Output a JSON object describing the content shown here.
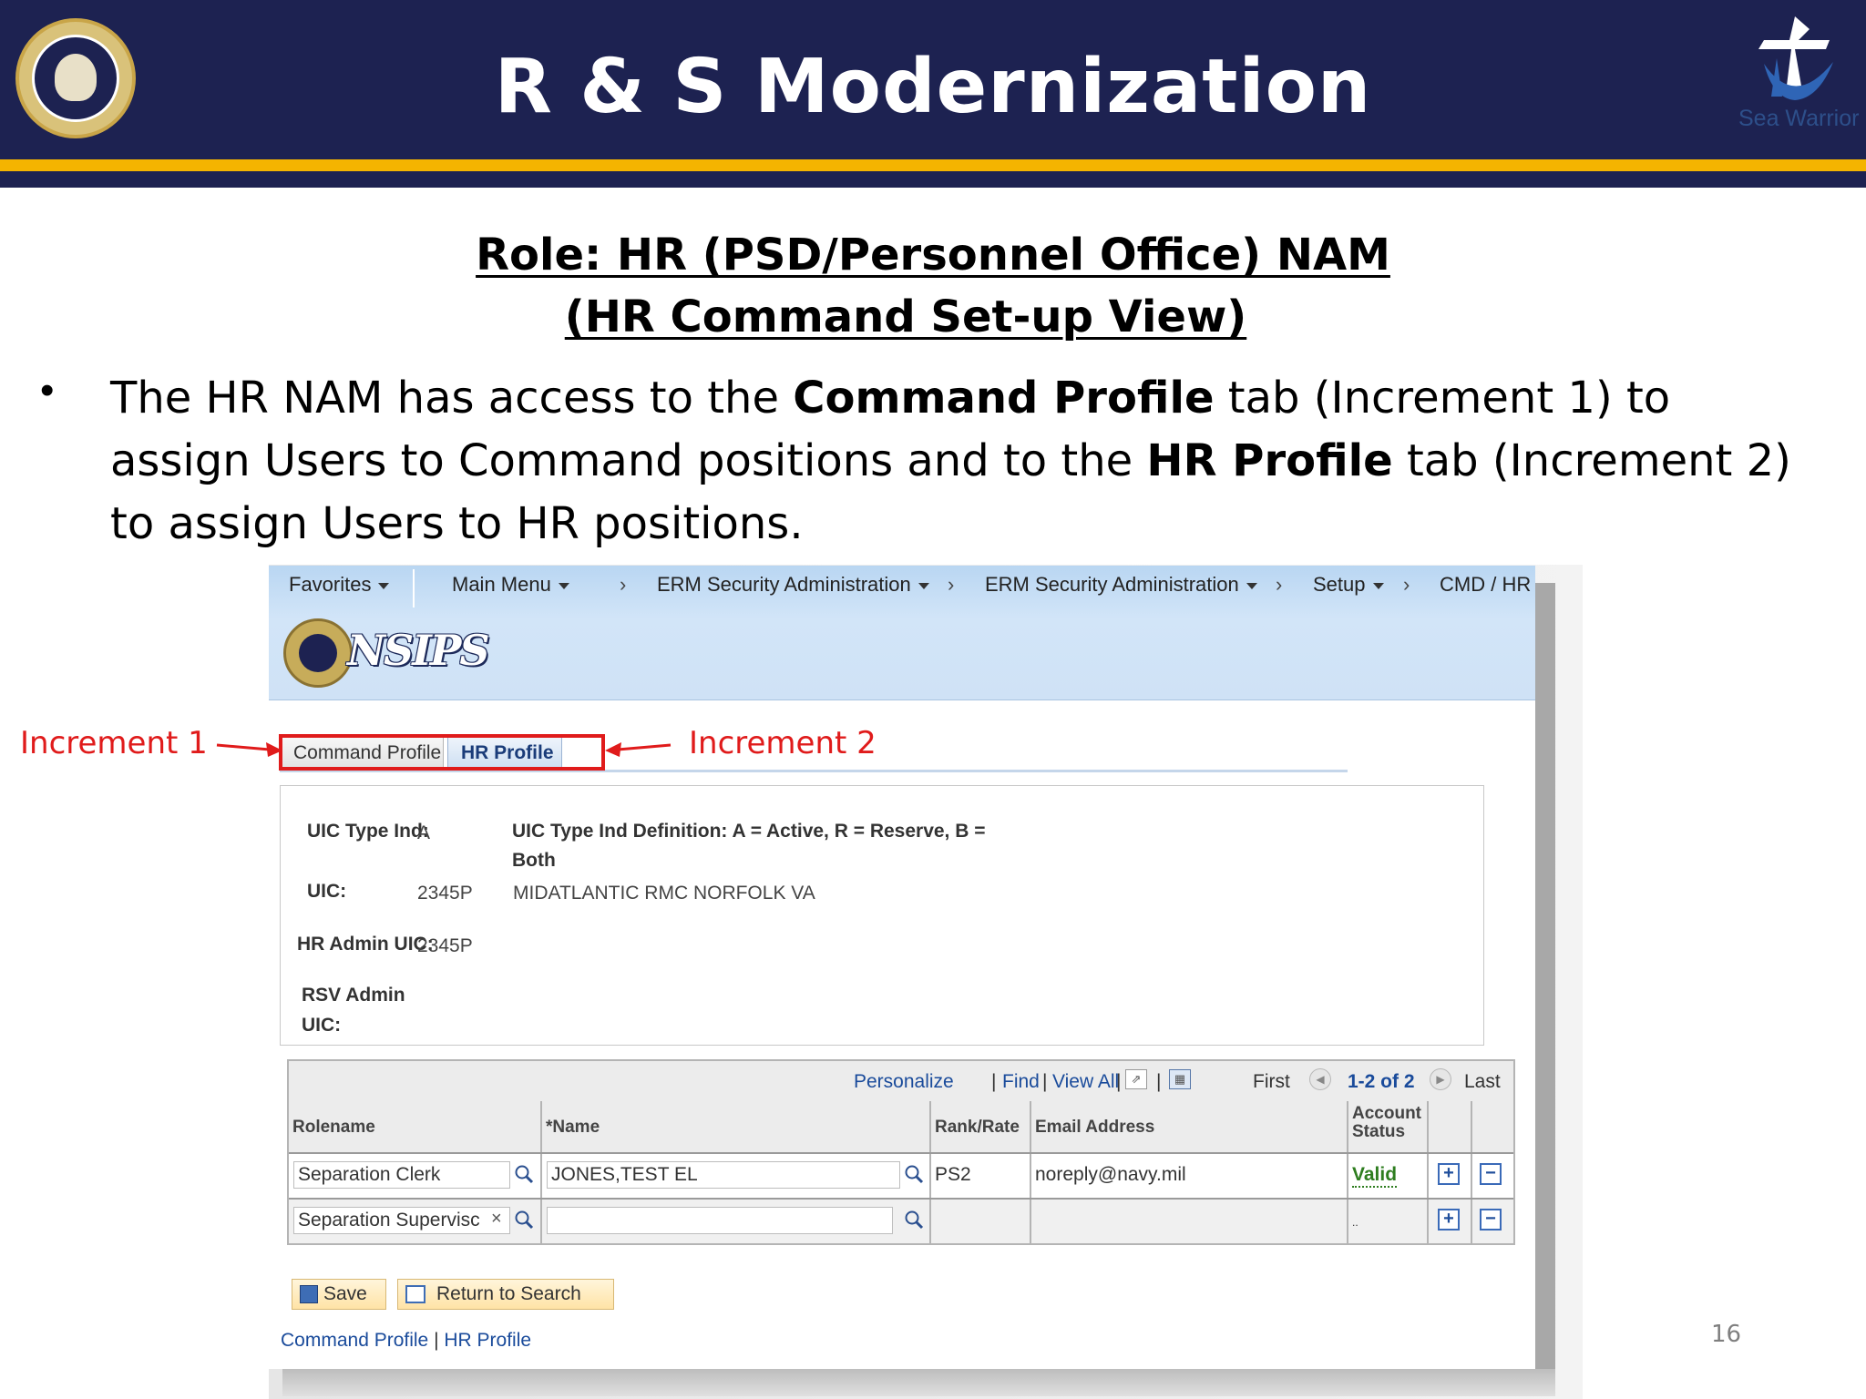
{
  "slide": {
    "title": "R & S Modernization",
    "heading_line1": "Role: HR (PSD/Personnel Office) NAM",
    "heading_line2": "(HR Command Set-up View)",
    "bullet_part1": "The HR NAM has access to the ",
    "bullet_bold1": "Command Profile",
    "bullet_part2": " tab (Increment 1) to assign Users to Command positions and to the ",
    "bullet_bold2": "HR Profile",
    "bullet_part3": " tab (Increment 2) to assign Users to HR positions.",
    "callout_left": "Increment 1",
    "callout_right": "Increment 2",
    "page_number": "16",
    "logo_right_text": "Sea Warrior"
  },
  "app": {
    "nav": {
      "favorites": "Favorites",
      "main_menu": "Main Menu",
      "crumb1": "ERM Security Administration",
      "crumb2": "ERM Security Administration",
      "crumb3": "Setup",
      "crumb4": "CMD / HR"
    },
    "logo_text": "NSIPS",
    "tabs": [
      "Command Profile",
      "HR Profile"
    ],
    "info": {
      "uic_type_ind_label": "UIC Type Ind:",
      "uic_type_ind_value": "A",
      "uic_type_def_line1": "UIC Type Ind Definition: A = Active, R = Reserve, B =",
      "uic_type_def_line2": "Both",
      "uic_label": "UIC:",
      "uic_value": "2345P",
      "uic_desc": "MIDATLANTIC RMC NORFOLK VA",
      "hr_admin_uic_label": "HR Admin UIC:",
      "hr_admin_uic_value": "2345P",
      "rsv_admin_label_line1": "RSV Admin",
      "rsv_admin_label_line2": "UIC:"
    },
    "grid": {
      "toolbar": {
        "personalize": "Personalize",
        "find": "Find",
        "view_all": "View All",
        "first": "First",
        "count": "1-2 of 2",
        "last": "Last"
      },
      "headers": {
        "rolename": "Rolename",
        "name": "*Name",
        "rank": "Rank/Rate",
        "email": "Email Address",
        "status_line1": "Account",
        "status_line2": "Status"
      },
      "rows": [
        {
          "rolename": "Separation Clerk",
          "name": "JONES,TEST EL",
          "rank": "PS2",
          "email": "noreply@navy.mil",
          "status": "Valid"
        },
        {
          "rolename": "Separation Supervisc",
          "name": "",
          "rank": "",
          "email": "",
          "status": ".."
        }
      ]
    },
    "buttons": {
      "save": "Save",
      "return": "Return to Search"
    },
    "bottom_links": [
      "Command Profile",
      "HR Profile"
    ]
  }
}
